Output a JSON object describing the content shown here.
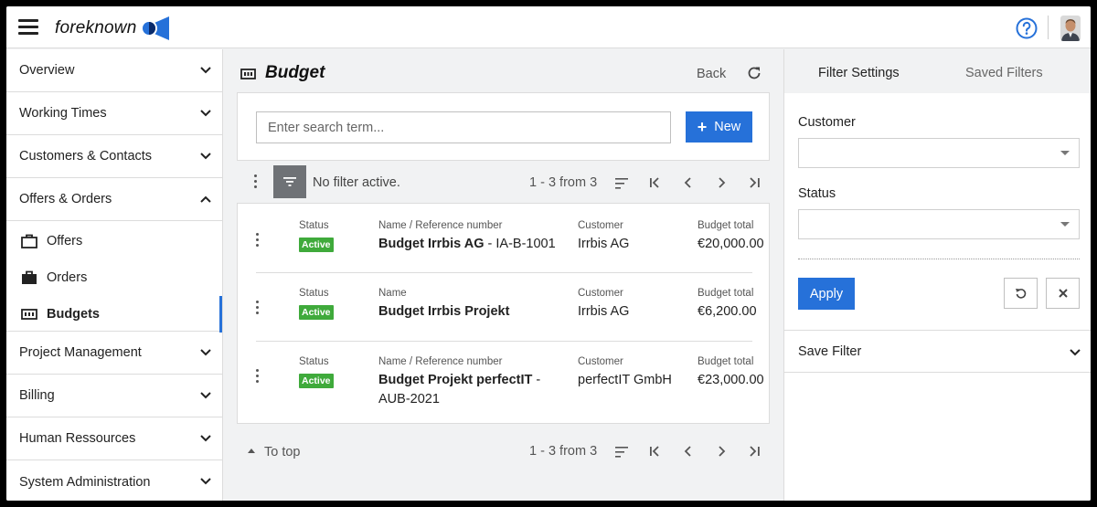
{
  "header": {
    "logo_text": "foreknown",
    "help_icon": "help-circle-icon",
    "brand_color": "#2671d9"
  },
  "sidebar": {
    "items_top": [
      {
        "label": "Overview",
        "expanded": false
      },
      {
        "label": "Working Times",
        "expanded": false
      },
      {
        "label": "Customers & Contacts",
        "expanded": false
      },
      {
        "label": "Offers & Orders",
        "expanded": true
      }
    ],
    "sub_items": [
      {
        "label": "Offers",
        "icon": "briefcase-outline-icon",
        "active": false
      },
      {
        "label": "Orders",
        "icon": "briefcase-filled-icon",
        "active": false
      },
      {
        "label": "Budgets",
        "icon": "budget-counter-icon",
        "active": true
      }
    ],
    "items_bottom": [
      {
        "label": "Project Management",
        "expanded": false
      },
      {
        "label": "Billing",
        "expanded": false
      },
      {
        "label": "Human Ressources",
        "expanded": false
      },
      {
        "label": "System Administration",
        "expanded": false
      }
    ]
  },
  "main": {
    "title": "Budget",
    "back_label": "Back",
    "search_placeholder": "Enter search term...",
    "new_label": "New",
    "filter_status": "No filter active.",
    "pager_text": "1 - 3 from 3",
    "to_top_label": "To top",
    "rows": [
      {
        "status_label": "Status",
        "status": "Active",
        "name_label": "Name / Reference number",
        "name": "Budget Irrbis AG",
        "ref": " - IA-B-1001",
        "name_line2": "",
        "customer_label": "Customer",
        "customer": "Irrbis AG",
        "total_label": "Budget total",
        "total": "€20,000.00"
      },
      {
        "status_label": "Status",
        "status": "Active",
        "name_label": "Name",
        "name": "Budget Irrbis Projekt",
        "ref": "",
        "name_line2": "",
        "customer_label": "Customer",
        "customer": "Irrbis AG",
        "total_label": "Budget total",
        "total": "€6,200.00"
      },
      {
        "status_label": "Status",
        "status": "Active",
        "name_label": "Name / Reference number",
        "name": "Budget Projekt perfectIT",
        "ref": " -",
        "name_line2": "AUB-2021",
        "customer_label": "Customer",
        "customer": "perfectIT GmbH",
        "total_label": "Budget total",
        "total": "€23,000.00"
      }
    ]
  },
  "filter_panel": {
    "tab_settings": "Filter Settings",
    "tab_saved": "Saved Filters",
    "customer_label": "Customer",
    "customer_value": "",
    "status_label": "Status",
    "status_value": "",
    "apply_label": "Apply",
    "save_filter_label": "Save Filter"
  }
}
